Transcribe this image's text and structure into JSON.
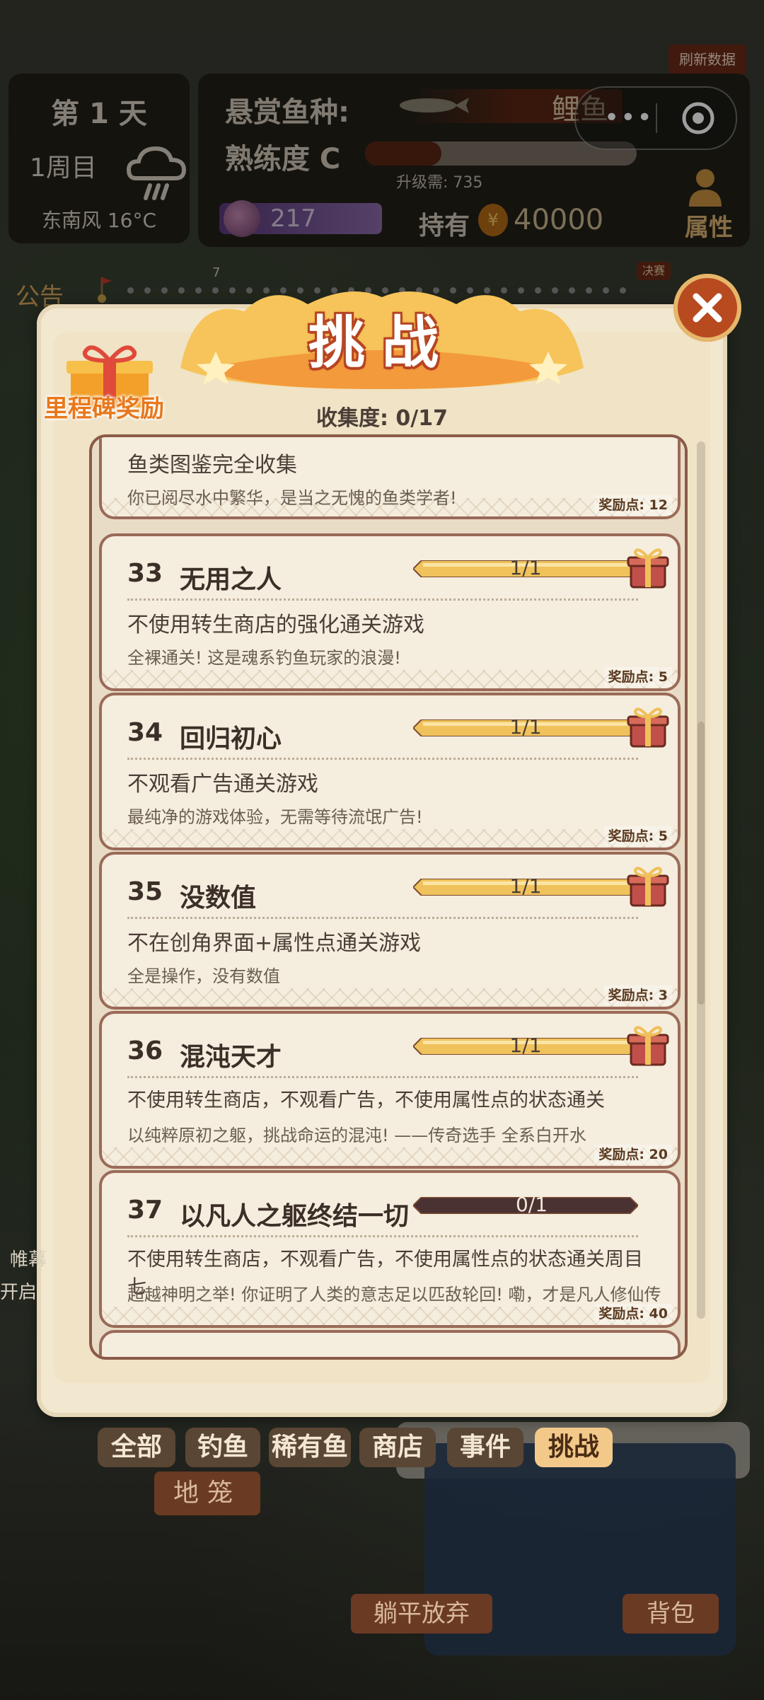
{
  "hud": {
    "refresh_label": "刷新数据",
    "day": "第 1 天",
    "cycle": "1周目",
    "wind_temp": "东南风 16°C",
    "bounty_label": "悬赏鱼种:",
    "bounty_fish": "鲤鱼",
    "proficiency_label": "熟练度 C",
    "proficiency_progress": 0.28,
    "upgrade_need": "升级需: 735",
    "gem_value": "217",
    "hold_label": "持有",
    "coin_symbol": "¥",
    "coin_value": "40000",
    "attributes_label": "属性",
    "notice_label": "公告",
    "stage_tick": "7",
    "final_label": "决赛",
    "menu_dots": "•••"
  },
  "dialog": {
    "title": "挑战",
    "milestone_label": "里程碑奖励",
    "collection": "收集度: 0/17",
    "items": [
      {
        "num": "",
        "title": "鱼类图鉴完全收集",
        "desc": "",
        "flavor": "你已阅尽水中繁华，是当之无愧的鱼类学者!",
        "progress": "",
        "points": "奖励点: 12"
      },
      {
        "num": "33",
        "title": "无用之人",
        "desc": "不使用转生商店的强化通关游戏",
        "flavor": "全裸通关! 这是魂系钓鱼玩家的浪漫!",
        "progress": "1/1",
        "points": "奖励点: 5"
      },
      {
        "num": "34",
        "title": "回归初心",
        "desc": "不观看广告通关游戏",
        "flavor": "最纯净的游戏体验，无需等待流氓广告!",
        "progress": "1/1",
        "points": "奖励点: 5"
      },
      {
        "num": "35",
        "title": "没数值",
        "desc": "不在创角界面+属性点通关游戏",
        "flavor": "全是操作，没有数值",
        "progress": "1/1",
        "points": "奖励点: 3"
      },
      {
        "num": "36",
        "title": "混沌天才",
        "desc": "不使用转生商店，不观看广告，不使用属性点的状态通关",
        "flavor": "以纯粹原初之躯，挑战命运的混沌! ——传奇选手 全系白开水",
        "progress": "1/1",
        "points": "奖励点: 20"
      },
      {
        "num": "37",
        "title": "以凡人之躯终结一切",
        "desc": "不使用转生商店，不观看广告，不使用属性点的状态通关周目七",
        "flavor": "超越神明之举! 你证明了人类的意志足以匹敌轮回! 嘞，才是凡人修仙传",
        "progress": "0/1",
        "points": "奖励点: 40"
      }
    ]
  },
  "tabs": [
    "全部",
    "钓鱼",
    "稀有鱼",
    "商店",
    "事件",
    "挑战"
  ],
  "active_tab": "挑战",
  "buttons": {
    "trap": "地笼",
    "give_up": "躺平放弃",
    "bag": "背包"
  },
  "side_text": {
    "a": "帷幕",
    "b": "开启"
  },
  "colors": {
    "accent": "#f3c98a",
    "banner": "#f6b25a",
    "bar_fill": "#f0c25c",
    "bar_empty": "#4a3232"
  }
}
